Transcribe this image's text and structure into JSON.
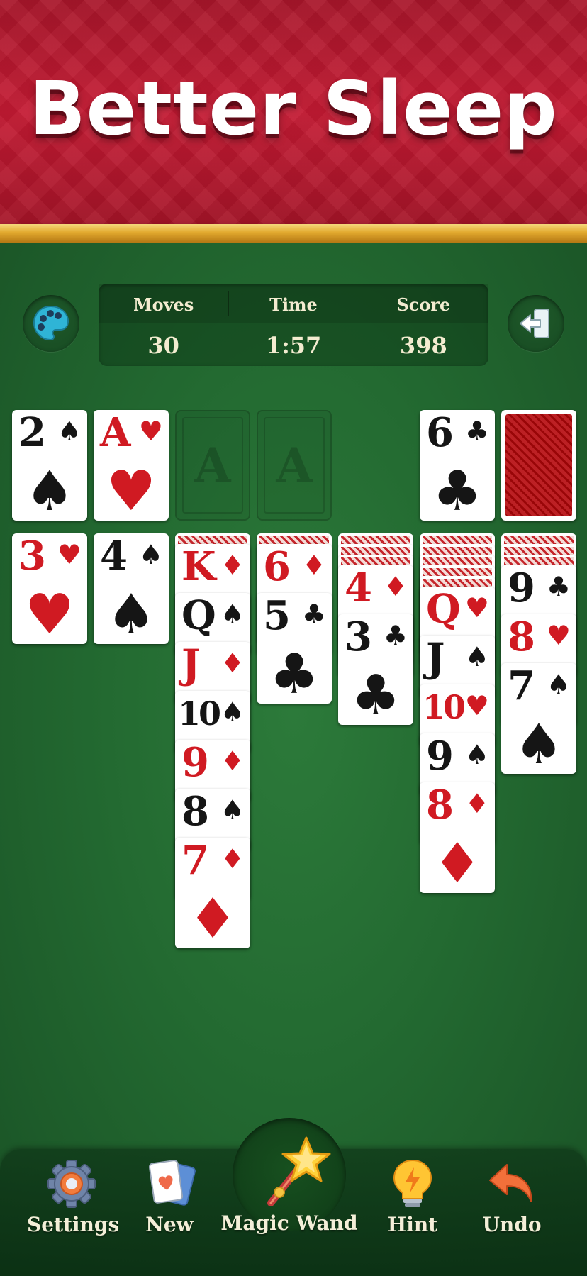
{
  "banner": {
    "title": "Better Sleep"
  },
  "stats": {
    "moves_label": "Moves",
    "moves_value": "30",
    "time_label": "Time",
    "time_value": "1:57",
    "score_label": "Score",
    "score_value": "398"
  },
  "icons": {
    "theme": "palette-icon",
    "exit": "exit-icon"
  },
  "top_row": {
    "foundations": [
      {
        "rank": "2",
        "suit": "♠",
        "color": "black"
      },
      {
        "rank": "A",
        "suit": "♥",
        "color": "red"
      },
      {
        "empty_label": "A"
      },
      {
        "empty_label": "A"
      }
    ],
    "waste": {
      "rank": "6",
      "suit": "♣",
      "color": "black"
    },
    "stock": "card-back"
  },
  "tableau": [
    {
      "hidden": 0,
      "cards": [
        {
          "rank": "3",
          "suit": "♥",
          "color": "red"
        }
      ]
    },
    {
      "hidden": 0,
      "cards": [
        {
          "rank": "4",
          "suit": "♠",
          "color": "black"
        }
      ]
    },
    {
      "hidden": 1,
      "cards": [
        {
          "rank": "K",
          "suit": "♦",
          "color": "red"
        },
        {
          "rank": "Q",
          "suit": "♠",
          "color": "black"
        },
        {
          "rank": "J",
          "suit": "♦",
          "color": "red"
        },
        {
          "rank": "10",
          "suit": "♠",
          "color": "black"
        },
        {
          "rank": "9",
          "suit": "♦",
          "color": "red"
        },
        {
          "rank": "8",
          "suit": "♠",
          "color": "black"
        },
        {
          "rank": "7",
          "suit": "♦",
          "color": "red"
        }
      ]
    },
    {
      "hidden": 1,
      "cards": [
        {
          "rank": "6",
          "suit": "♦",
          "color": "red"
        },
        {
          "rank": "5",
          "suit": "♣",
          "color": "black"
        }
      ]
    },
    {
      "hidden": 3,
      "cards": [
        {
          "rank": "4",
          "suit": "♦",
          "color": "red"
        },
        {
          "rank": "3",
          "suit": "♣",
          "color": "black"
        }
      ]
    },
    {
      "hidden": 5,
      "cards": [
        {
          "rank": "Q",
          "suit": "♥",
          "color": "red"
        },
        {
          "rank": "J",
          "suit": "♠",
          "color": "black"
        },
        {
          "rank": "10",
          "suit": "♥",
          "color": "red"
        },
        {
          "rank": "9",
          "suit": "♠",
          "color": "black"
        },
        {
          "rank": "8",
          "suit": "♦",
          "color": "red"
        }
      ]
    },
    {
      "hidden": 3,
      "cards": [
        {
          "rank": "9",
          "suit": "♣",
          "color": "black"
        },
        {
          "rank": "8",
          "suit": "♥",
          "color": "red"
        },
        {
          "rank": "7",
          "suit": "♠",
          "color": "black"
        }
      ]
    }
  ],
  "toolbar": {
    "settings_label": "Settings",
    "new_label": "New",
    "magic_wand_label": "Magic Wand",
    "hint_label": "Hint",
    "undo_label": "Undo"
  }
}
